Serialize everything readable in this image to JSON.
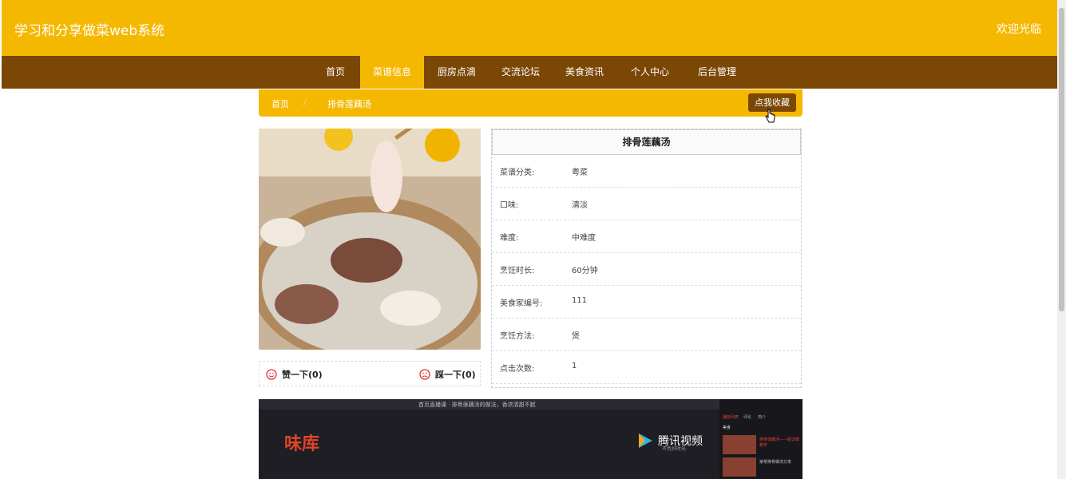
{
  "header": {
    "site_title": "学习和分享做菜web系统",
    "welcome": "欢迎光临"
  },
  "nav": [
    "首页",
    "菜谱信息",
    "厨房点滴",
    "交流论坛",
    "美食资讯",
    "个人中心",
    "后台管理"
  ],
  "nav_active": "菜谱信息",
  "breadcrumb": {
    "home": "首页",
    "sep": "/",
    "current": "排骨莲藕汤"
  },
  "favorite_button": "点我收藏",
  "likes": {
    "like": "赞一下(0)",
    "dislike": "踩一下(0)"
  },
  "recipe": {
    "title": "排骨莲藕汤",
    "rows": [
      {
        "label": "菜谱分类:",
        "value": "粤菜"
      },
      {
        "label": "口味:",
        "value": "清淡"
      },
      {
        "label": "难度:",
        "value": "中难度"
      },
      {
        "label": "烹饪时长:",
        "value": "60分钟"
      },
      {
        "label": "美食家编号:",
        "value": "111"
      },
      {
        "label": "烹饪方法:",
        "value": "煲"
      },
      {
        "label": "点击次数:",
        "value": "1"
      }
    ]
  },
  "video": {
    "top_text": "首页直播课  ·  排骨莲藕汤的做法，香浓清甜不腻",
    "brand": "味库",
    "logo": "腾讯视频",
    "logo_sub": "不负好时光",
    "side_tabs": [
      "播放列表",
      "评论",
      "简介"
    ],
    "side_label": "美食",
    "side_items": [
      "排骨莲藕汤——超详细教学",
      "家常排骨做法分享"
    ]
  },
  "colors": {
    "primary": "#f5b800",
    "nav": "#7a4705"
  }
}
